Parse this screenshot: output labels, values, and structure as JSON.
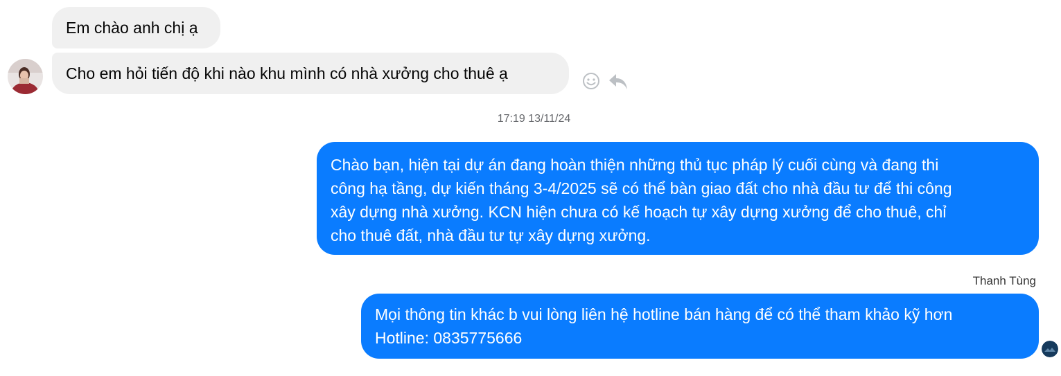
{
  "conversation": {
    "incoming": [
      {
        "text": "Em chào anh chị ạ"
      },
      {
        "text": "Cho em hỏi tiến độ khi nào khu mình có nhà xưởng cho thuê ạ"
      }
    ],
    "timestamp": "17:19 13/11/24",
    "outgoing": [
      {
        "lines": [
          "Chào bạn, hiện tại dự án đang hoàn thiện những thủ tục pháp lý cuối cùng và đang thi",
          "công hạ tầng, dự kiến tháng 3-4/2025 sẽ có thể bàn giao đất cho nhà đầu tư để thi công",
          "xây dựng nhà xưởng. KCN hiện chưa có kế hoạch tự xây dựng xưởng để cho thuê, chỉ",
          "cho thuê đất, nhà đầu tư tự xây dựng xưởng."
        ]
      },
      {
        "sender_name": "Thanh Tùng",
        "lines": [
          "Mọi thông tin khác b vui lòng liên hệ hotline bán hàng để có thể tham khảo kỹ hơn",
          "Hotline: 0835775666"
        ]
      }
    ]
  },
  "icons": {
    "react": "smiley-icon",
    "reply": "reply-arrow-icon",
    "seen": "seen-avatar-icon"
  },
  "colors": {
    "outgoing_bubble": "#0a7cff",
    "incoming_bubble": "#f0f0f0",
    "timestamp": "#65676b"
  }
}
